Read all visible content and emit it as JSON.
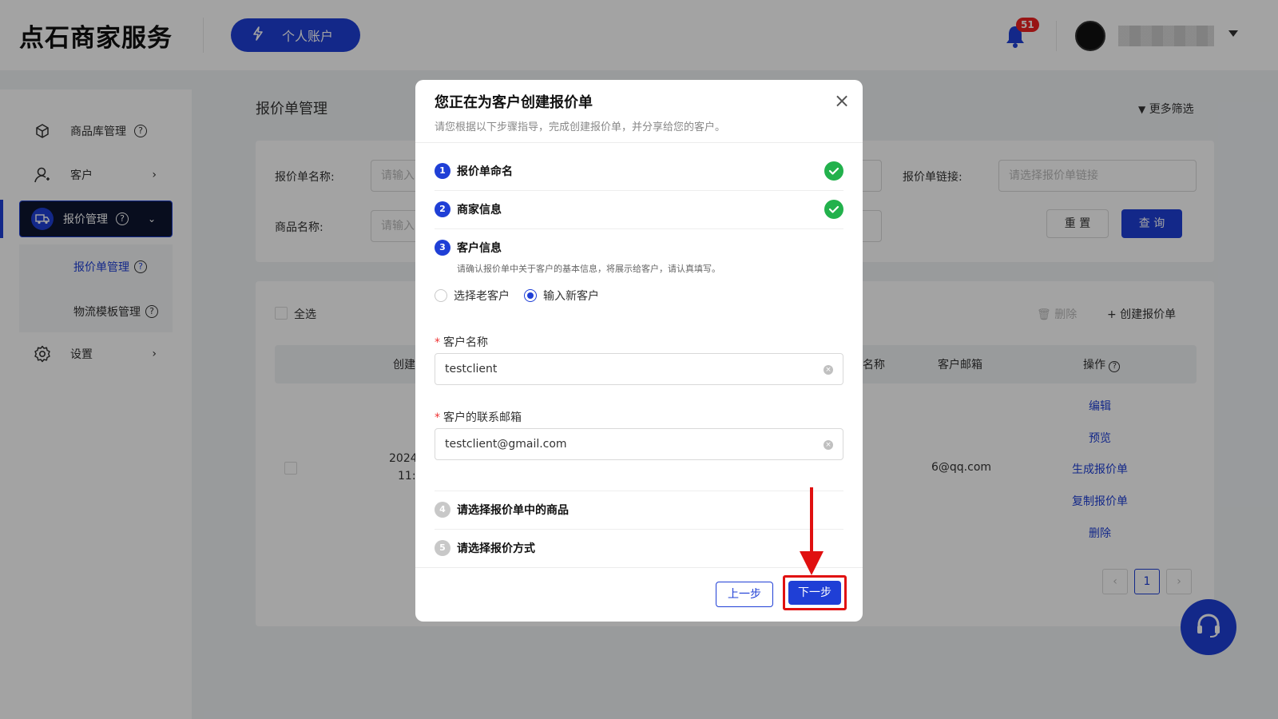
{
  "header": {
    "logo": "点石商家服务",
    "account_button": "个人账户",
    "notification_count": "51"
  },
  "sidebar": {
    "items": [
      {
        "label": "商品库管理",
        "icon": "box-icon"
      },
      {
        "label": "客户",
        "icon": "user-icon"
      },
      {
        "label": "报价管理",
        "icon": "truck-icon"
      },
      {
        "label": "设置",
        "icon": "gear-icon"
      }
    ],
    "subitems": [
      {
        "label": "报价单管理"
      },
      {
        "label": "物流模板管理"
      }
    ]
  },
  "main": {
    "title": "报价单管理",
    "more_filter": "更多筛选",
    "filters": {
      "name_label": "报价单名称:",
      "name_placeholder": "请输入",
      "goods_label": "商品名称:",
      "goods_placeholder": "请输入",
      "link_label": "报价单链接:",
      "link_placeholder": "请选择报价单链接"
    },
    "reset_button": "重 置",
    "query_button": "查 询",
    "select_all": "全选",
    "delete_action": "删除",
    "create_action": "+ 创建报价单",
    "columns": [
      "创建",
      "名称",
      "客户邮箱",
      "操作"
    ],
    "row": {
      "date_line1": "2024",
      "date_line2": "11:",
      "name_fragment": "6",
      "email": "6@qq.com"
    },
    "ops": [
      "编辑",
      "预览",
      "生成报价单",
      "复制报价单",
      "删除"
    ],
    "page": "1"
  },
  "modal": {
    "title": "您正在为客户创建报价单",
    "subtitle": "请您根据以下步骤指导，完成创建报价单，并分享给您的客户。",
    "steps": [
      {
        "num": "1",
        "label": "报价单命名"
      },
      {
        "num": "2",
        "label": "商家信息"
      },
      {
        "num": "3",
        "label": "客户信息"
      },
      {
        "num": "4",
        "label": "请选择报价单中的商品"
      },
      {
        "num": "5",
        "label": "请选择报价方式"
      }
    ],
    "step3_desc": "请确认报价单中关于客户的基本信息，将展示给客户，请认真填写。",
    "radio_old": "选择老客户",
    "radio_new": "输入新客户",
    "name_label": "客户名称",
    "name_value": "testclient",
    "email_label": "客户的联系邮箱",
    "email_value": "testclient@gmail.com",
    "prev_button": "上一步",
    "next_button": "下一步"
  },
  "colors": {
    "primary": "#1f3fd6",
    "success": "#22b14c",
    "annotation": "#e01010"
  }
}
